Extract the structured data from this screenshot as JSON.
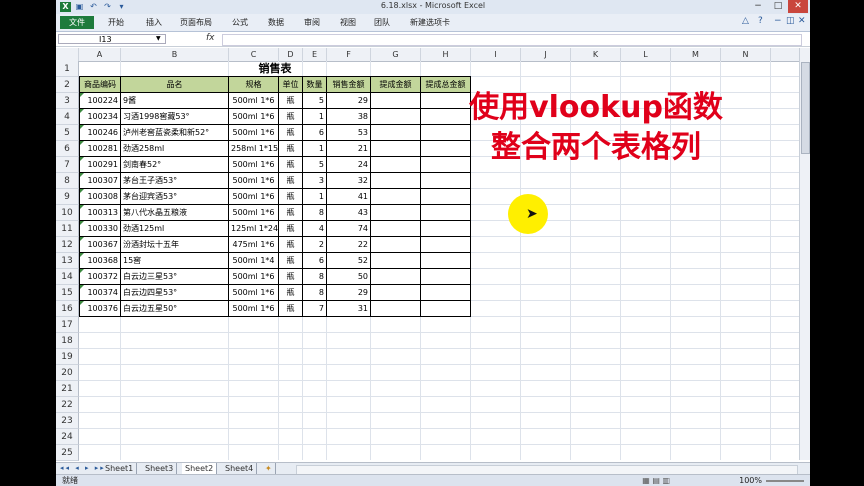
{
  "window": {
    "title": "6.18.xlsx - Microsoft Excel"
  },
  "ribbon": {
    "tabs": [
      "文件",
      "开始",
      "插入",
      "页面布局",
      "公式",
      "数据",
      "审阅",
      "视图",
      "团队",
      "新建选项卡"
    ]
  },
  "formula_bar": {
    "name_box": "I13",
    "fx": "fx",
    "value": ""
  },
  "columns": [
    "A",
    "B",
    "C",
    "D",
    "E",
    "F",
    "G",
    "H",
    "I",
    "J",
    "K",
    "L",
    "M",
    "N"
  ],
  "rows": [
    "1",
    "2",
    "3",
    "4",
    "5",
    "6",
    "7",
    "8",
    "9",
    "10",
    "11",
    "12",
    "13",
    "14",
    "15",
    "16",
    "17",
    "18",
    "19",
    "20",
    "21",
    "22",
    "23",
    "24",
    "25"
  ],
  "sheet": {
    "title": "销售表",
    "headers": [
      "商品编码",
      "品名",
      "规格",
      "单位",
      "数量",
      "销售金额",
      "提成金额",
      "提成总金额"
    ],
    "data": [
      [
        "100224",
        "9酱",
        "500ml 1*6",
        "瓶",
        "5",
        "29"
      ],
      [
        "100234",
        "习酒1998窖藏53°",
        "500ml 1*6",
        "瓶",
        "1",
        "38"
      ],
      [
        "100246",
        "泸州老窖蓝瓷柔和新52°",
        "500ml 1*6",
        "瓶",
        "6",
        "53"
      ],
      [
        "100281",
        "劲酒258ml",
        "258ml 1*15",
        "瓶",
        "1",
        "21"
      ],
      [
        "100291",
        "剑南春52°",
        "500ml 1*6",
        "瓶",
        "5",
        "24"
      ],
      [
        "100307",
        "茅台王子酒53°",
        "500ml 1*6",
        "瓶",
        "3",
        "32"
      ],
      [
        "100308",
        "茅台迎宾酒53°",
        "500ml 1*6",
        "瓶",
        "1",
        "41"
      ],
      [
        "100313",
        "第八代水晶五粮液",
        "500ml 1*6",
        "瓶",
        "8",
        "43"
      ],
      [
        "100330",
        "劲酒125ml",
        "125ml 1*24",
        "瓶",
        "4",
        "74"
      ],
      [
        "100367",
        "汾酒封坛十五年",
        "475ml 1*6",
        "瓶",
        "2",
        "22"
      ],
      [
        "100368",
        "15窖",
        "500ml 1*4",
        "瓶",
        "6",
        "52"
      ],
      [
        "100372",
        "白云边三星53°",
        "500ml 1*6",
        "瓶",
        "8",
        "50"
      ],
      [
        "100374",
        "白云边四星53°",
        "500ml 1*6",
        "瓶",
        "8",
        "29"
      ],
      [
        "100376",
        "白云边五星50°",
        "500ml 1*6",
        "瓶",
        "7",
        "31"
      ]
    ]
  },
  "overlay": {
    "line1": "使用vlookup函数",
    "line2": "整合两个表格列",
    "color": "#e0001a"
  },
  "sheet_tabs": [
    "Sheet1",
    "Sheet3",
    "Sheet2",
    "Sheet4"
  ],
  "active_sheet": "Sheet2",
  "status": {
    "ready": "就绪",
    "zoom": "100%"
  }
}
